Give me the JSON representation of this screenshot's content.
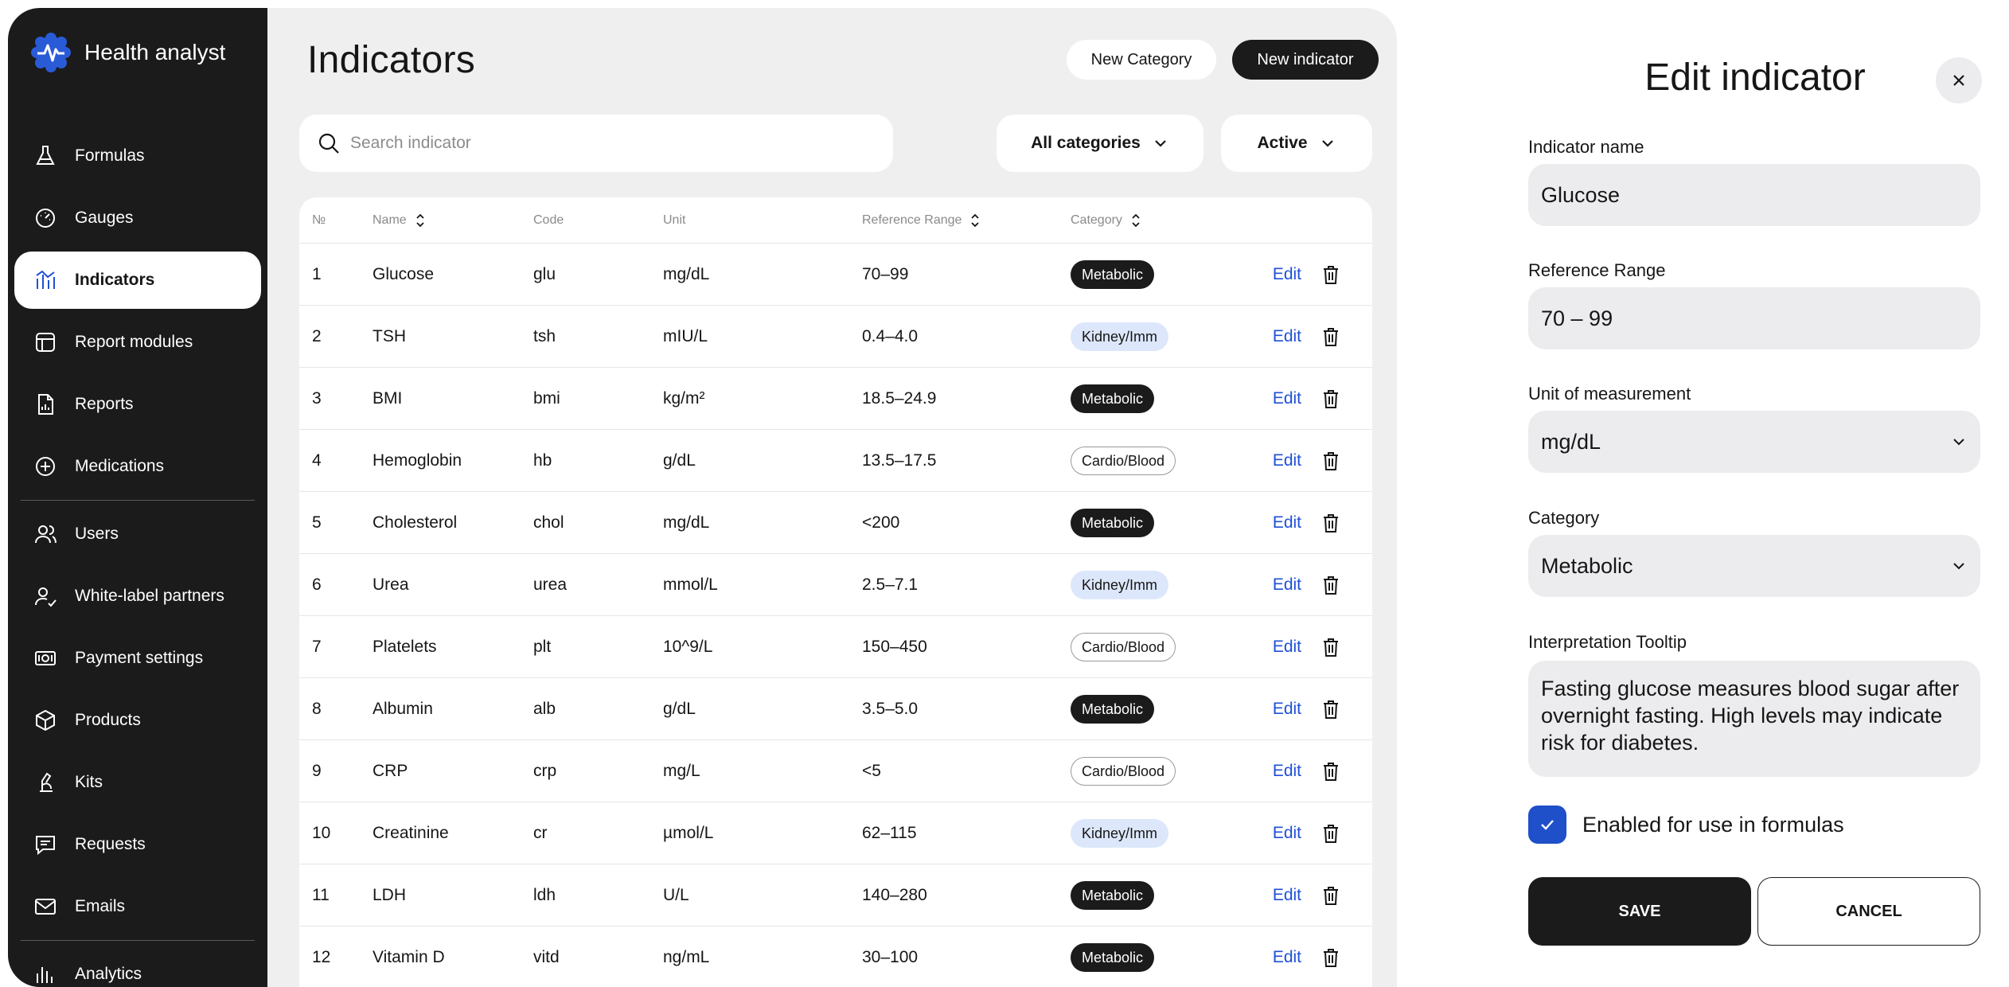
{
  "app": {
    "name": "Health analyst"
  },
  "sidebar": {
    "items": [
      {
        "label": "Formulas",
        "icon": "flask-icon"
      },
      {
        "label": "Gauges",
        "icon": "gauge-icon"
      },
      {
        "label": "Indicators",
        "icon": "indicators-chart-icon",
        "active": true
      },
      {
        "label": "Report modules",
        "icon": "layout-icon"
      },
      {
        "label": "Reports",
        "icon": "report-icon"
      },
      {
        "label": "Medications",
        "icon": "medication-icon"
      },
      {
        "label": "Users",
        "icon": "users-icon"
      },
      {
        "label": "White-label partners",
        "icon": "partner-icon"
      },
      {
        "label": "Payment settings",
        "icon": "payment-icon"
      },
      {
        "label": "Products",
        "icon": "box-icon"
      },
      {
        "label": "Kits",
        "icon": "kit-icon"
      },
      {
        "label": "Requests",
        "icon": "chat-icon"
      },
      {
        "label": "Emails",
        "icon": "mail-icon"
      },
      {
        "label": "Analytics",
        "icon": "bar-chart-icon"
      }
    ]
  },
  "main": {
    "title": "Indicators",
    "new_category": "New Category",
    "new_indicator": "New indicator",
    "search_placeholder": "Search indicator",
    "filter_category": "All categories",
    "filter_status": "Active"
  },
  "table": {
    "headers": {
      "no": "№",
      "name": "Name",
      "code": "Code",
      "unit": "Unit",
      "range": "Reference Range",
      "category": "Category"
    },
    "edit_label": "Edit",
    "rows": [
      {
        "no": "1",
        "name": "Glucose",
        "code": "glu",
        "unit": "mg/dL",
        "range": "70–99",
        "category": "Metabolic",
        "style": "dark"
      },
      {
        "no": "2",
        "name": "TSH",
        "code": "tsh",
        "unit": "mIU/L",
        "range": "0.4–4.0",
        "category": "Kidney/Imm",
        "style": "blue"
      },
      {
        "no": "3",
        "name": "BMI",
        "code": "bmi",
        "unit": "kg/m²",
        "range": "18.5–24.9",
        "category": "Metabolic",
        "style": "dark"
      },
      {
        "no": "4",
        "name": "Hemoglobin",
        "code": "hb",
        "unit": "g/dL",
        "range": "13.5–17.5",
        "category": "Cardio/Blood",
        "style": "outline"
      },
      {
        "no": "5",
        "name": "Cholesterol",
        "code": "chol",
        "unit": "mg/dL",
        "range": "<200",
        "category": "Metabolic",
        "style": "dark"
      },
      {
        "no": "6",
        "name": "Urea",
        "code": "urea",
        "unit": "mmol/L",
        "range": "2.5–7.1",
        "category": "Kidney/Imm",
        "style": "blue"
      },
      {
        "no": "7",
        "name": "Platelets",
        "code": "plt",
        "unit": "10^9/L",
        "range": "150–450",
        "category": "Cardio/Blood",
        "style": "outline"
      },
      {
        "no": "8",
        "name": "Albumin",
        "code": "alb",
        "unit": "g/dL",
        "range": "3.5–5.0",
        "category": "Metabolic",
        "style": "dark"
      },
      {
        "no": "9",
        "name": "CRP",
        "code": "crp",
        "unit": "mg/L",
        "range": "<5",
        "category": "Cardio/Blood",
        "style": "outline"
      },
      {
        "no": "10",
        "name": "Creatinine",
        "code": "cr",
        "unit": "µmol/L",
        "range": "62–115",
        "category": "Kidney/Imm",
        "style": "blue"
      },
      {
        "no": "11",
        "name": "LDH",
        "code": "ldh",
        "unit": "U/L",
        "range": "140–280",
        "category": "Metabolic",
        "style": "dark"
      },
      {
        "no": "12",
        "name": "Vitamin D",
        "code": "vitd",
        "unit": "ng/mL",
        "range": "30–100",
        "category": "Metabolic",
        "style": "dark"
      }
    ]
  },
  "panel": {
    "title": "Edit indicator",
    "name_label": "Indicator name",
    "name_value": "Glucose",
    "range_label": "Reference Range",
    "range_value": "70 – 99",
    "unit_label": "Unit of measurement",
    "unit_value": "mg/dL",
    "category_label": "Category",
    "category_value": "Metabolic",
    "tooltip_label": "Interpretation Tooltip",
    "tooltip_value": "Fasting glucose measures blood sugar after overnight fasting. High levels may indicate risk for diabetes.",
    "enabled_label": "Enabled for use in formulas",
    "enabled": true,
    "save": "SAVE",
    "cancel": "CANCEL"
  },
  "colors": {
    "sidebar_bg": "#1b1b1b",
    "accent_blue": "#2050d6",
    "checkbox_blue": "#1f4fc9",
    "badge_blue_bg": "#dde7fb"
  }
}
